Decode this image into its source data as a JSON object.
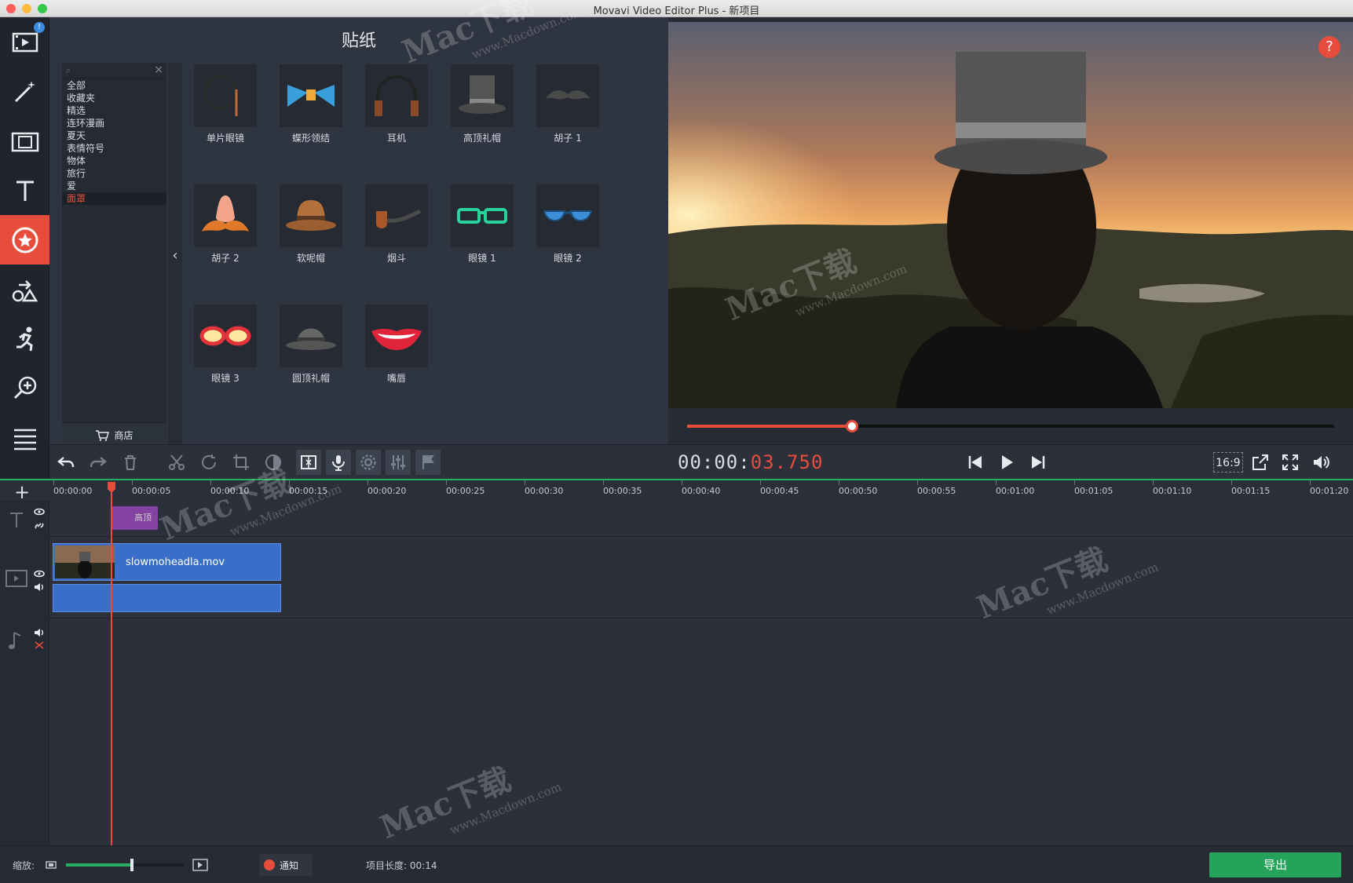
{
  "window": {
    "title": "Movavi Video Editor Plus - 新项目"
  },
  "rail": {
    "badge": "!"
  },
  "panel": {
    "title": "贴纸",
    "categories": [
      "全部",
      "收藏夹",
      "精选",
      "连环漫画",
      "夏天",
      "表情符号",
      "物体",
      "旅行",
      "爱",
      "面罩"
    ],
    "selected_category": "面罩",
    "store_label": "商店",
    "stickers": [
      {
        "label": "单片眼镜",
        "icon": "monocle-icon"
      },
      {
        "label": "蝶形领结",
        "icon": "bowtie-icon"
      },
      {
        "label": "耳机",
        "icon": "headphones-icon"
      },
      {
        "label": "高顶礼帽",
        "icon": "top-hat-icon"
      },
      {
        "label": "胡子 1",
        "icon": "mustache-icon"
      },
      {
        "label": "胡子 2",
        "icon": "nose-mustache-icon"
      },
      {
        "label": "软呢帽",
        "icon": "fedora-icon"
      },
      {
        "label": "烟斗",
        "icon": "pipe-icon"
      },
      {
        "label": "眼镜 1",
        "icon": "glasses-green-icon"
      },
      {
        "label": "眼镜 2",
        "icon": "glasses-blue-icon"
      },
      {
        "label": "眼镜 3",
        "icon": "glasses-red-icon"
      },
      {
        "label": "圆顶礼帽",
        "icon": "bowler-hat-icon"
      },
      {
        "label": "嘴唇",
        "icon": "lips-icon"
      }
    ]
  },
  "preview": {
    "help": "?",
    "progress_fraction": 0.255,
    "timecode_dim": "00:00:",
    "timecode_hot": "03.750",
    "aspect_ratio": "16:9"
  },
  "timeline": {
    "ticks": [
      "00:00:00",
      "00:00:05",
      "00:00:10",
      "00:00:15",
      "00:00:20",
      "00:00:25",
      "00:00:30",
      "00:00:35",
      "00:00:40",
      "00:00:45",
      "00:00:50",
      "00:00:55",
      "00:01:00",
      "00:01:05",
      "00:01:10",
      "00:01:15",
      "00:01:20"
    ],
    "sticker_clip_label": "高顶",
    "video_clip_name": "slowmoheadla.mov"
  },
  "status": {
    "zoom_label": "缩放:",
    "zoom_fraction": 0.56,
    "notification_label": "通知",
    "project_length_label": "项目长度:",
    "project_length_value": "00:14",
    "export_label": "导出"
  },
  "watermark": {
    "brand": "Mac下载",
    "url": "www.Macdown.com"
  },
  "colors": {
    "accent": "#e74d3c",
    "export": "#25a35a",
    "clip": "#3a6fc9",
    "sticker_clip": "#8e44ad"
  }
}
